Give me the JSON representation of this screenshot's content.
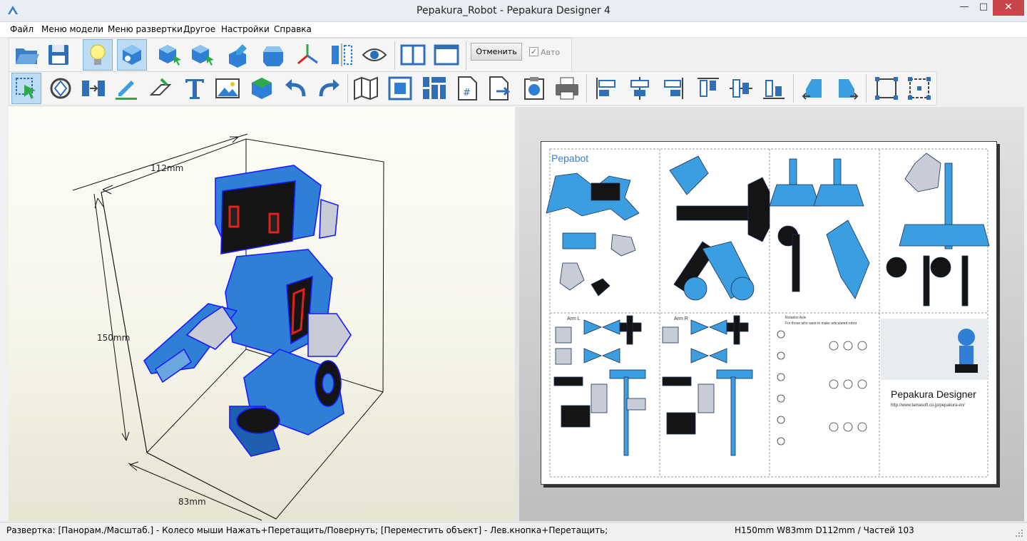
{
  "window": {
    "title": "Pepakura_Robot - Pepakura Designer 4",
    "minimize_glyph": "—",
    "maximize_glyph": "□",
    "close_glyph": "✕"
  },
  "menu": [
    "Файл",
    "Меню модели",
    "Меню развертки",
    "Другое",
    "Настройки",
    "Справка"
  ],
  "toolbar1": {
    "icons": [
      "open-folder-icon",
      "save-icon",
      "lightbulb-icon",
      "paint-cube-icon",
      "select-cube-icon",
      "move-cube-icon",
      "cube-edit-icon",
      "hexagon-cube-icon",
      "axes-icon",
      "mirror-icon",
      "eye-refresh-icon",
      "two-pane-icon",
      "one-pane-icon"
    ],
    "cancel_label": "Отменить",
    "auto_checked": true,
    "auto_label": "Авто"
  },
  "toolbar2": {
    "icons": [
      "select-move-icon",
      "rotate-icon",
      "join-icon",
      "pencil-line-icon",
      "fold-line-icon",
      "text-icon",
      "image-icon",
      "green-cube-icon",
      "undo-icon",
      "redo-icon",
      "map-icon",
      "fit-page-icon",
      "layout-icon",
      "page-number-icon",
      "export-icon",
      "print-icon",
      "printer-icon",
      "align-left-icon",
      "align-center-icon",
      "align-right-icon",
      "align-top-icon",
      "align-middle-icon",
      "align-bottom-icon",
      "rotate-left-icon",
      "rotate-right-icon",
      "group-icon",
      "ungroup-icon"
    ]
  },
  "view3d": {
    "dim_width": "112mm",
    "dim_height": "150mm",
    "dim_depth": "83mm"
  },
  "pattern": {
    "title": "Pepabot",
    "cell_labels": [
      "Arm L",
      "Arm R",
      "Rotation Axis",
      "For those who want to make articulated robot"
    ],
    "brand": "Pepakura Designer",
    "url": "http://www.tamasoft.co.jp/pepakura-en/"
  },
  "status": {
    "left": "Развертка: [Панорам./Масштаб.] - Колесо мыши Нажать+Перетащить/Повернуть; [Переместить объект] - Лев.кнопка+Перетащить;",
    "right": "H150mm W83mm D112mm / Частей 103"
  },
  "colors": {
    "robot_blue": "#2f7fd6",
    "robot_edge": "#1a1aff",
    "pattern_blue": "#3a9ee0",
    "accent_red": "#e0201a",
    "close_red": "#c7464a"
  }
}
